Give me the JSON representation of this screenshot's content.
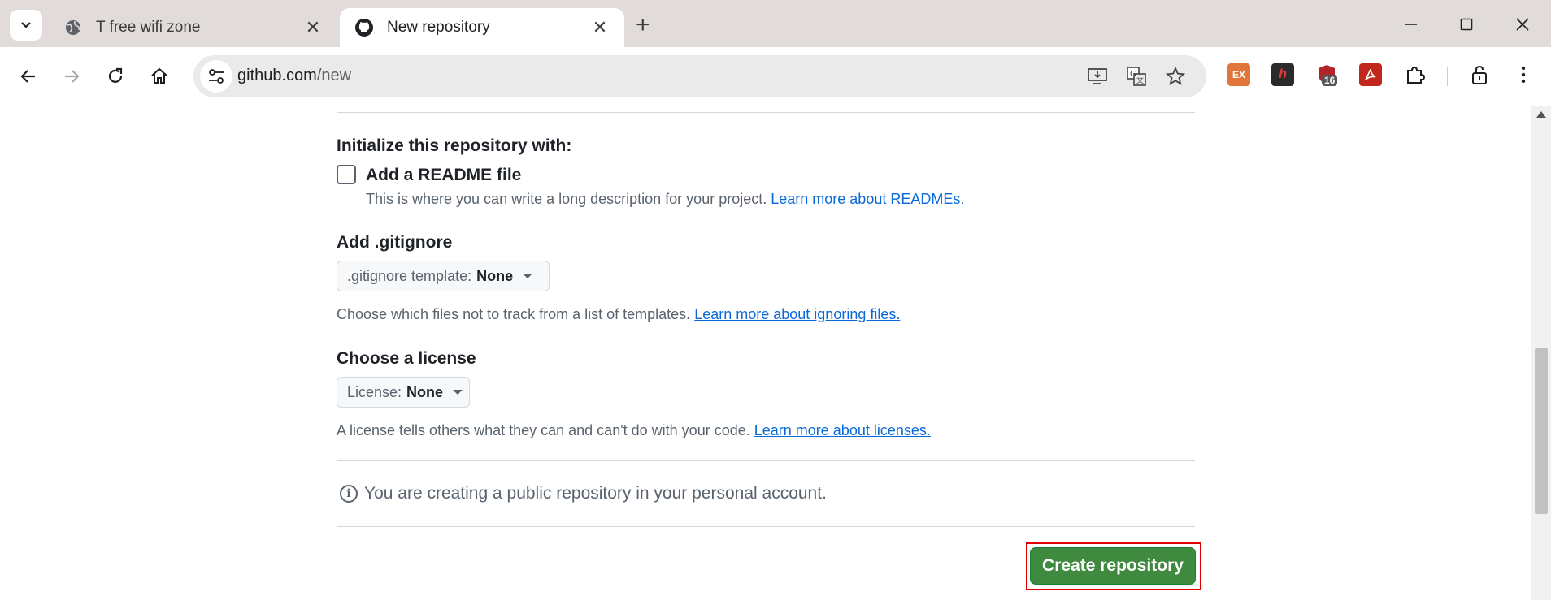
{
  "browser": {
    "tabs": [
      {
        "title": "T free wifi zone",
        "icon": "globe-icon",
        "active": false
      },
      {
        "title": "New repository",
        "icon": "github-icon",
        "active": true
      }
    ],
    "new_tab_label": "+",
    "address": {
      "host": "github.com",
      "path": "/new"
    },
    "extensions": [
      {
        "name": "ex-extension",
        "label": "EX",
        "color": "#e0763a"
      },
      {
        "name": "h-extension",
        "label": "h",
        "color": "#2b2b2b"
      },
      {
        "name": "shield-extension",
        "label": "",
        "color": "#b3232a",
        "badge": "16"
      },
      {
        "name": "pdf-extension",
        "label": "",
        "color": "#c1271d"
      }
    ]
  },
  "form": {
    "initialize_heading": "Initialize this repository with:",
    "readme_label": "Add a README file",
    "readme_checked": false,
    "readme_note": "This is where you can write a long description for your project.",
    "readme_link": "Learn more about READMEs.",
    "gitignore_heading": "Add .gitignore",
    "gitignore_key": ".gitignore template:",
    "gitignore_value": "None",
    "gitignore_note": "Choose which files not to track from a list of templates.",
    "gitignore_link": "Learn more about ignoring files.",
    "license_heading": "Choose a license",
    "license_key": "License:",
    "license_value": "None",
    "license_note": "A license tells others what they can and can't do with your code.",
    "license_link": "Learn more about licenses.",
    "info_text": "You are creating a public repository in your personal account.",
    "create_button": "Create repository"
  },
  "colors": {
    "accent": "#0969da",
    "primary_button": "#3f8a3f",
    "highlight_box": "#e00000"
  }
}
